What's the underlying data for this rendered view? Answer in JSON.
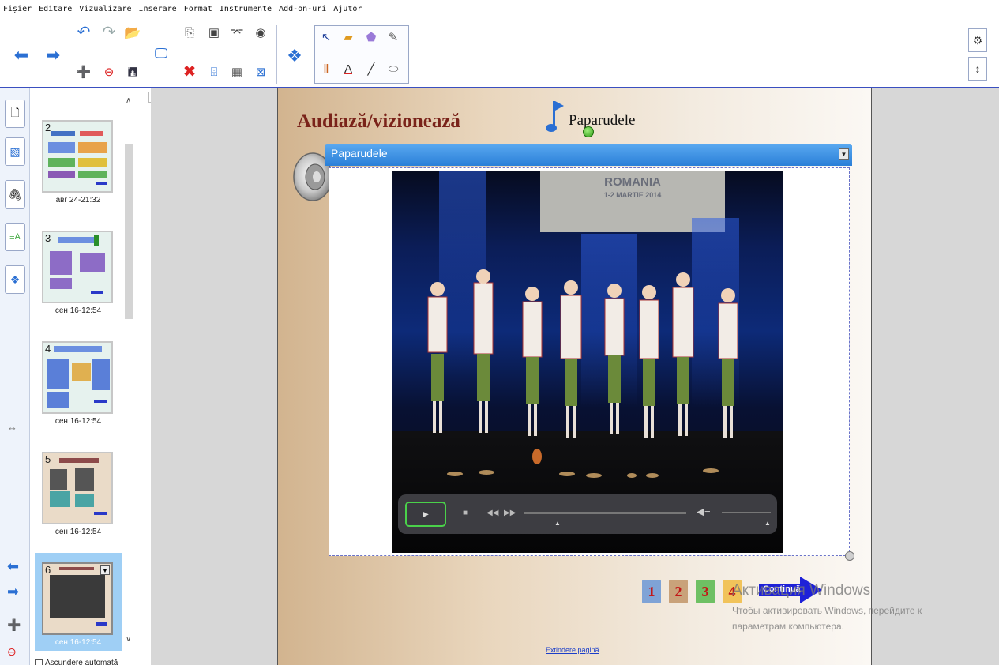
{
  "menu": [
    "Fișier",
    "Editare",
    "Vizualizare",
    "Inserare",
    "Format",
    "Instrumente",
    "Add-on-uri",
    "Ajutor"
  ],
  "toolbar": {
    "back_icon": "arrow-left-icon",
    "forward_icon": "arrow-right-icon",
    "right_buttons": [
      "gear-icon",
      "updown-arrows-icon"
    ]
  },
  "side_tabs": [
    "page-sorter-icon",
    "gallery-icon",
    "attachments-icon",
    "properties-icon",
    "addons-icon"
  ],
  "sorter": {
    "pages": [
      {
        "num": "2",
        "time": "авг 24-21:32"
      },
      {
        "num": "3",
        "time": "сен 16-12:54"
      },
      {
        "num": "4",
        "time": "сен 16-12:54"
      },
      {
        "num": "5",
        "time": "сен 16-12:54"
      },
      {
        "num": "6",
        "time": "сен 16-12:54",
        "selected": true
      }
    ],
    "auto_hide": "Ascundere automată"
  },
  "slide": {
    "heading": "Audiază/vizionează",
    "song_title": "Paparudele",
    "media_title": "Paparudele",
    "video_banner": [
      "ROMANIA",
      "1-2 MARTIE 2014"
    ],
    "nav_numbers": [
      "1",
      "2",
      "3",
      "4"
    ],
    "continue_label": "Continuă",
    "expand_link": "Extindere pagină"
  },
  "watermark": {
    "title": "Активация Windows",
    "line1": "Чтобы активировать Windows, перейдите к",
    "line2": "параметрам компьютера."
  },
  "colors": {
    "heading": "#7a231a",
    "media_header": "#2a7fd8",
    "nav_1": "#7fa3d6",
    "nav_2": "#c9a27a",
    "nav_3": "#6ec063",
    "nav_4": "#f1c35a",
    "continue": "#1e21d8"
  }
}
